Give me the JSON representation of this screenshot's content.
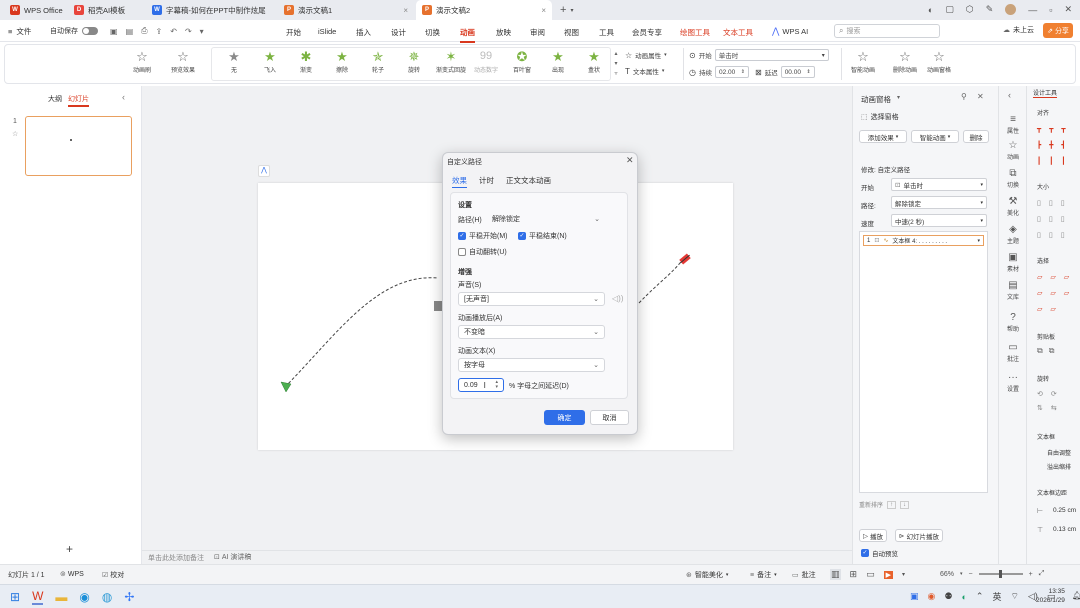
{
  "titlebar": {
    "tabs": [
      {
        "label": "WPS Office",
        "icon": "wps-logo",
        "color": "#d9381e"
      },
      {
        "label": "稻壳AI模板",
        "icon": "docer-logo",
        "color": "#e8453c"
      },
      {
        "label": "字幕稿-如何在PPT中制作炫尾动画.d",
        "icon": "word-logo",
        "color": "#2f6ee8"
      },
      {
        "label": "演示文稿1",
        "icon": "ppt-logo",
        "color": "#e6712e"
      },
      {
        "label": "演示文稿2",
        "icon": "ppt-logo",
        "color": "#e6712e"
      }
    ],
    "new_tab": "+"
  },
  "menubar": {
    "file": "文件",
    "autosave": "自动保存",
    "items": [
      "开始",
      "iSlide",
      "插入",
      "设计",
      "切换",
      "动画",
      "放映",
      "审阅",
      "视图",
      "工具",
      "会员专享",
      "绘图工具",
      "文本工具",
      "WPS AI"
    ],
    "active": "动画",
    "search_placeholder": "搜索",
    "cloud": "未上云",
    "share": "分享"
  },
  "ribbon": {
    "left_buttons": [
      "动画刷",
      "预览效果"
    ],
    "effects": [
      "无",
      "飞入",
      "渐变",
      "擦除",
      "轮子",
      "旋转",
      "渐变式回旋",
      "动态数字",
      "百叶窗",
      "出现",
      "盒状"
    ],
    "props": {
      "anim_props": "动画属性",
      "text_props": "文本属性",
      "start_label": "开始",
      "start_value": "单击时",
      "duration_label": "持续",
      "duration_value": "02.00",
      "delay_label": "延迟",
      "delay_value": "00.00"
    },
    "right_buttons": [
      "智能动画",
      "删除动画",
      "动画窗格"
    ]
  },
  "leftpanel": {
    "tab_outline": "大纲",
    "tab_slides": "幻灯片",
    "slide_number": "1",
    "add_label": "+"
  },
  "canvas": {
    "notes_placeholder": "单击此处添加备注",
    "ai_label": "AI 演讲稿"
  },
  "dialog": {
    "title": "自定义路径",
    "tabs": [
      "效果",
      "计时",
      "正文文本动画"
    ],
    "active_tab": "效果",
    "settings_heading": "设置",
    "path_label": "路径(H)",
    "path_value": "解除锁定",
    "smooth_start": "平稳开始(M)",
    "smooth_start_checked": true,
    "smooth_end": "平稳结束(N)",
    "smooth_end_checked": true,
    "auto_reverse": "自动翻转(U)",
    "auto_reverse_checked": false,
    "enhance_heading": "增强",
    "sound_label": "声音(S)",
    "sound_value": "[无声音]",
    "after_label": "动画播放后(A)",
    "after_value": "不变暗",
    "text_label": "动画文本(X)",
    "text_value": "按字母",
    "delay_value": "0.09",
    "delay_suffix": "% 字母之间延迟(D)",
    "ok": "确定",
    "cancel": "取消"
  },
  "animpane": {
    "title": "动画窗格",
    "select_pane": "选择窗格",
    "add_effect": "添加效果",
    "smart_anim": "智能动画",
    "delete": "删除",
    "modify": "修改: 自定义路径",
    "start_label": "开始",
    "start_value": "单击时",
    "path_label": "路径:",
    "path_value": "解除锁定",
    "speed_label": "速度",
    "speed_value": "中速(2 秒)",
    "item_number": "1",
    "item_label": "文本框 4: . . . . . . . . .",
    "reorder": "重新排序",
    "play": "播放",
    "slideshow": "幻灯片播放",
    "auto_preview": "自动预览",
    "auto_preview_checked": true
  },
  "sideicons": [
    "属性",
    "动画",
    "切换",
    "美化",
    "主题",
    "素材",
    "文库",
    "帮助",
    "批注",
    "设置"
  ],
  "designpane": {
    "title": "设计工具",
    "sections": [
      "对齐",
      "大小",
      "选择",
      "剪贴板",
      "旋转",
      "文本框"
    ],
    "textbox_opts": [
      "自由调整",
      "溢出缩排"
    ],
    "margin_title": "文本框边距",
    "margin_1": "0.25 cm",
    "margin_2": "0.13 cm"
  },
  "statusbar": {
    "slide_info": "幻灯片 1 / 1",
    "wps": "WPS",
    "proof": "校对",
    "beautify": "智能美化",
    "notes": "备注",
    "comments": "批注",
    "zoom": "66%"
  },
  "taskbar": {
    "lang": "英",
    "time": "13:35",
    "date": "2026/1/29"
  }
}
